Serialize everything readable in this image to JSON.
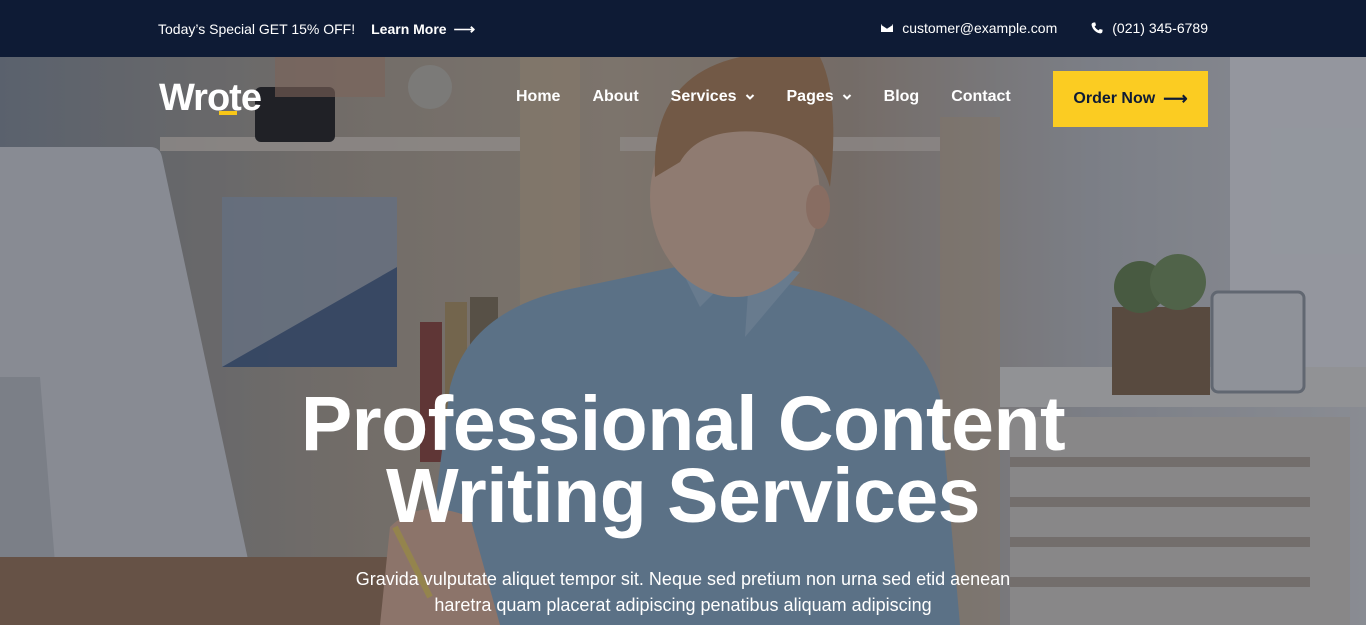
{
  "topbar": {
    "promo_text": "Today’s Special GET 15% OFF!",
    "learn_more": "Learn More",
    "email": "customer@example.com",
    "phone": "(021) 345-6789"
  },
  "logo": "Wrote",
  "nav": {
    "items": [
      "Home",
      "About",
      "Services",
      "Pages",
      "Blog",
      "Contact"
    ],
    "order_button": "Order Now"
  },
  "hero": {
    "headline_line1": "Professional Content",
    "headline_line2": "Writing Services",
    "sub_line1": "Gravida vulputate aliquet tempor sit. Neque sed pretium non urna sed etid aenean",
    "sub_line2": "haretra quam placerat adipiscing penatibus aliquam adipiscing"
  },
  "colors": {
    "topbar_bg": "#0e1b35",
    "accent": "#fbcc22"
  }
}
